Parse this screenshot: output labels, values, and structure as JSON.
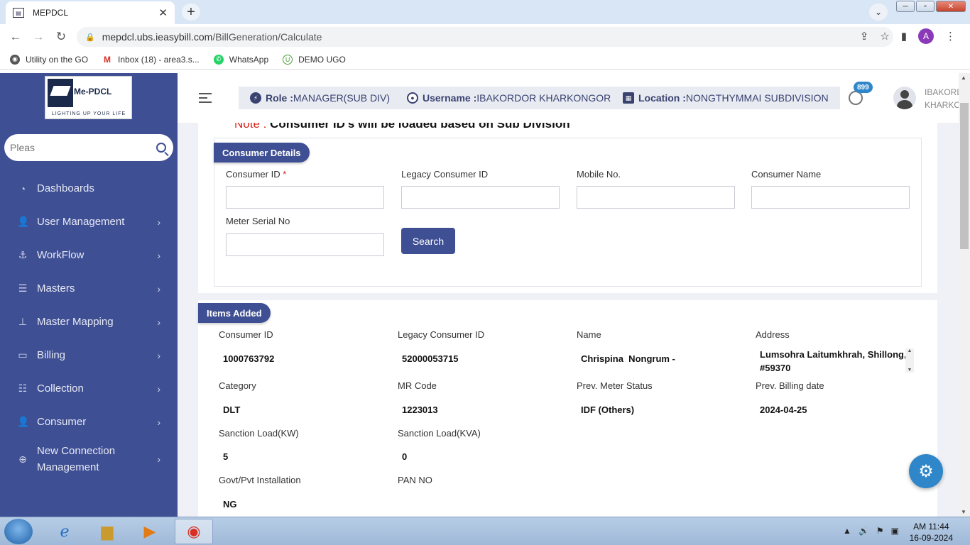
{
  "browser": {
    "tab_title": "MEPDCL",
    "tab_close": "✕",
    "new_tab": "+",
    "url_domain": "mepdcl.ubs.ieasybill.com",
    "url_path": "/BillGeneration/Calculate",
    "profile_initial": "A",
    "bookmarks": [
      {
        "label": "Utility on the GO"
      },
      {
        "label": "Inbox (18) - area3.s..."
      },
      {
        "label": "WhatsApp"
      },
      {
        "label": "DEMO UGO"
      }
    ]
  },
  "logo": {
    "name": "Me-PDCL",
    "tagline": "LIGHTING UP YOUR LIFE"
  },
  "sidebar": {
    "search_placeholder": "Pleas",
    "items": [
      {
        "label": "Dashboards",
        "icon": "dashboard-icon"
      },
      {
        "label": "User Management",
        "icon": "user-icon"
      },
      {
        "label": "WorkFlow",
        "icon": "anchor-icon"
      },
      {
        "label": "Masters",
        "icon": "list-icon"
      },
      {
        "label": "Master Mapping",
        "icon": "sitemap-icon"
      },
      {
        "label": "Billing",
        "icon": "monitor-icon"
      },
      {
        "label": "Collection",
        "icon": "list-icon"
      },
      {
        "label": "Consumer",
        "icon": "user-icon"
      },
      {
        "label": "New Connection Management",
        "icon": "plus-circle-icon"
      }
    ]
  },
  "header": {
    "role_label": "Role :",
    "role_value": "MANAGER(SUB DIV)",
    "username_label": "Username :",
    "username_value": "IBAKORDOR KHARKONGOR",
    "location_label": "Location :",
    "location_value": "NONGTHYMMAI SUBDIVISION",
    "notification_count": "899",
    "user_name_line1": "IBAKORD",
    "user_name_line2": "KHARKO"
  },
  "note": {
    "prefix": "Note :",
    "text": "Consumer ID's will be loaded based on Sub Division"
  },
  "consumer_details": {
    "title": "Consumer Details",
    "fields": {
      "consumer_id": "Consumer ID",
      "required_mark": "*",
      "legacy_id": "Legacy Consumer ID",
      "mobile": "Mobile No.",
      "name": "Consumer Name",
      "meter_serial": "Meter Serial No"
    },
    "search_button": "Search"
  },
  "items_added": {
    "title": "Items Added",
    "rows": [
      [
        {
          "label": "Consumer ID",
          "value": "1000763792"
        },
        {
          "label": "Legacy Consumer ID",
          "value": "52000053715"
        },
        {
          "label": "Name",
          "value": "Chrispina  Nongrum -"
        },
        {
          "label": "Address",
          "value": "Lumsohra Laitumkhrah, Shillong, #59370"
        }
      ],
      [
        {
          "label": "Category",
          "value": "DLT"
        },
        {
          "label": "MR Code",
          "value": "1223013"
        },
        {
          "label": "Prev. Meter Status",
          "value": "IDF (Others)"
        },
        {
          "label": "Prev. Billing date",
          "value": "2024-04-25"
        }
      ],
      [
        {
          "label": "Sanction Load(KW)",
          "value": "5"
        },
        {
          "label": "Sanction Load(KVA)",
          "value": "0"
        }
      ],
      [
        {
          "label": "Govt/Pvt Installation",
          "value": "NG"
        },
        {
          "label": "PAN NO",
          "value": ""
        }
      ]
    ]
  },
  "taskbar": {
    "time": "AM 11:44",
    "date": "16-09-2024"
  }
}
